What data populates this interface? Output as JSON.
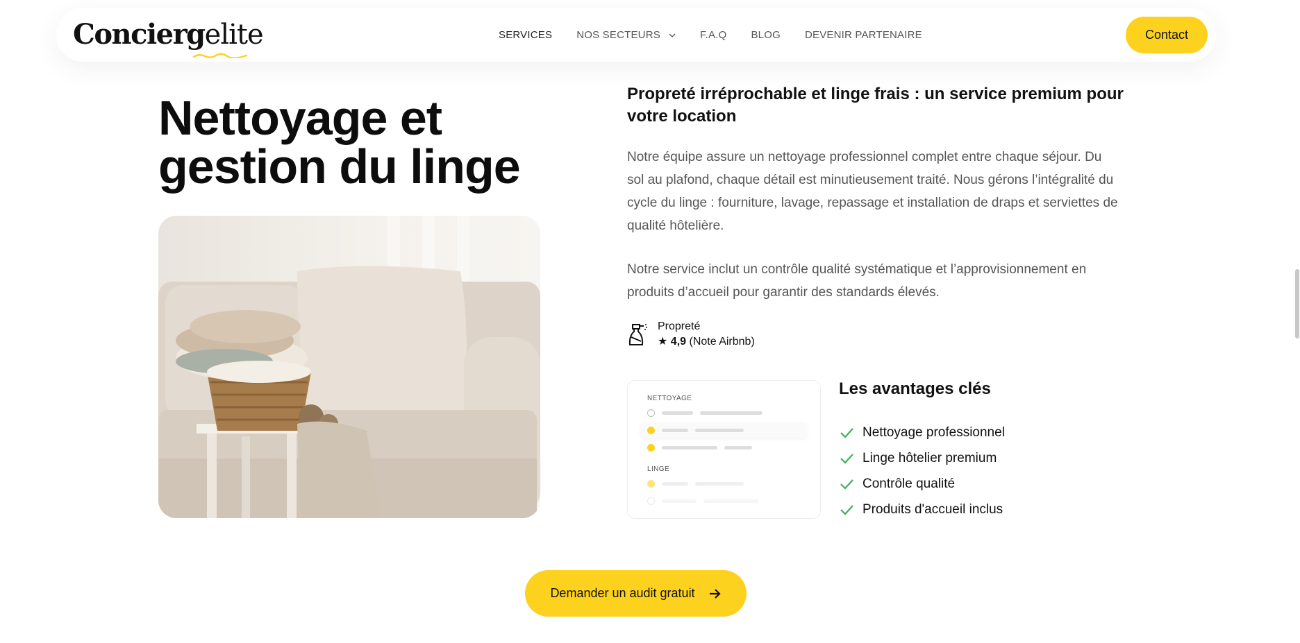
{
  "header": {
    "logo_bold": "Concierg",
    "logo_light": "elite",
    "nav": [
      {
        "label": "SERVICES"
      },
      {
        "label": "NOS SECTEURS"
      },
      {
        "label": "F.A.Q"
      },
      {
        "label": "BLOG"
      },
      {
        "label": "DEVENIR PARTENAIRE"
      }
    ],
    "contact_label": "Contact"
  },
  "hero": {
    "title_line1": "Nettoyage et",
    "title_line2": "gestion du linge",
    "image_alt": "Panier de linge plié sur un tabouret devant un canapé beige"
  },
  "content": {
    "subtitle": "Propreté irréprochable et linge frais : un service premium pour votre location",
    "paragraph1": "Notre équipe assure un nettoyage professionnel complet entre chaque séjour. Du sol au plafond, chaque détail est minutieusement traité. Nous gérons l’intégralité du cycle du linge : fourniture, lavage, repassage et installation de draps et serviettes de qualité hôtelière.",
    "paragraph2": "Notre service inclut un contrôle qualité systématique et l’approvisionnement en produits d’accueil pour garantir des standards élevés.",
    "rating_label": "Propreté",
    "rating_star": "★",
    "rating_score": "4,9",
    "rating_source": "(Note Airbnb)"
  },
  "mock_card": {
    "section1": "NETTOYAGE",
    "section2": "LINGE"
  },
  "advantages": {
    "title": "Les avantages clés",
    "items": [
      {
        "label": "Nettoyage professionnel"
      },
      {
        "label": "Linge hôtelier premium"
      },
      {
        "label": "Contrôle qualité"
      },
      {
        "label": "Produits d'accueil inclus"
      }
    ]
  },
  "cta": {
    "label": "Demander un audit gratuit"
  },
  "colors": {
    "accent": "#FDD21F",
    "check": "#3fae5a",
    "text": "#111111",
    "muted": "#555555"
  }
}
